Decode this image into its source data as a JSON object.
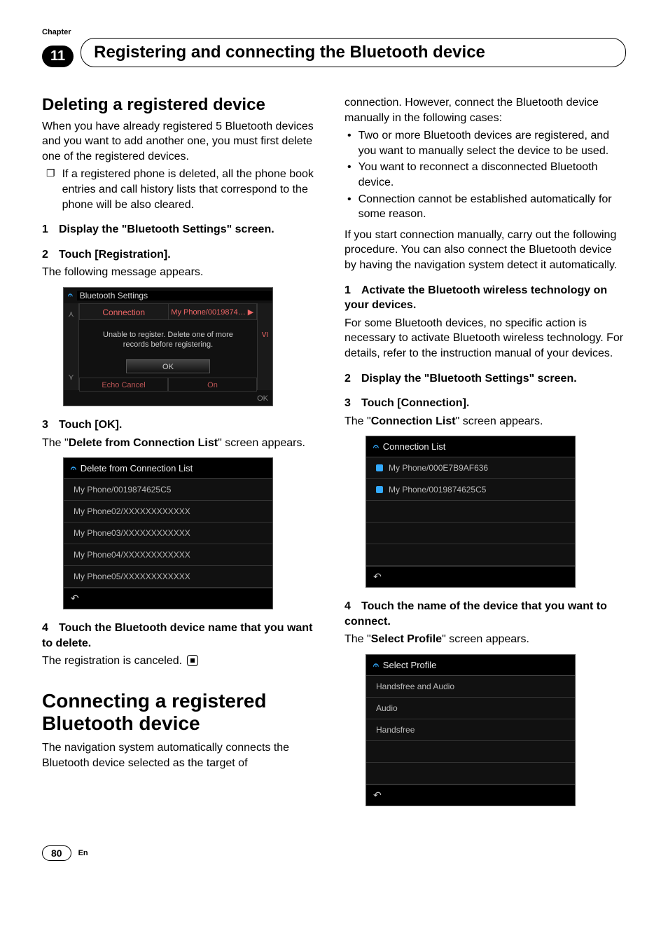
{
  "chapter": {
    "label": "Chapter",
    "number": "11",
    "title": "Registering and connecting the Bluetooth device"
  },
  "left": {
    "h_delete": "Deleting a registered device",
    "delete_intro": "When you have already registered 5 Bluetooth devices and you want to add another one, you must first delete one of the registered devices.",
    "note_marker": "❐",
    "note_text": "If a registered phone is deleted, all the phone book entries and call history lists that correspond to the phone will be also cleared.",
    "s1_head": "Display the \"Bluetooth Settings\" screen.",
    "s2_head": "Touch [Registration].",
    "s2_body": "The following message appears.",
    "s3_head": "Touch [OK].",
    "s3_body_pre": "The \"",
    "s3_body_bold": "Delete from Connection List",
    "s3_body_post": "\" screen appears.",
    "s4_head": "Touch the Bluetooth device name that you want to delete.",
    "s4_body": "The registration is canceled.",
    "h_connect": "Connecting a registered Bluetooth device",
    "connect_intro": "The navigation system automatically connects the Bluetooth device selected as the target of"
  },
  "right": {
    "cont": "connection. However, connect the Bluetooth device manually in the following cases:",
    "bullets": [
      "Two or more Bluetooth devices are registered, and you want to manually select the device to be used.",
      "You want to reconnect a disconnected Bluetooth device.",
      "Connection cannot be established automatically for some reason."
    ],
    "after_bullets": "If you start connection manually, carry out the following procedure. You can also connect the Bluetooth device by having the navigation system detect it automatically.",
    "s1_head": "Activate the Bluetooth wireless technology on your devices.",
    "s1_body": "For some Bluetooth devices, no specific action is necessary to activate Bluetooth wireless technology. For details, refer to the instruction manual of your devices.",
    "s2_head": "Display the \"Bluetooth Settings\" screen.",
    "s3_head": "Touch [Connection].",
    "s3_body_pre": "The \"",
    "s3_body_bold": "Connection List",
    "s3_body_post": "\" screen appears.",
    "s4_head": "Touch the name of the device that you want to connect.",
    "s4_body_pre": "The \"",
    "s4_body_bold": "Select Profile",
    "s4_body_post": "\" screen appears."
  },
  "shot1": {
    "title": "Bluetooth Settings",
    "conn": "Connection",
    "phone": "My Phone/0019874…",
    "msg1": "Unable to register.  Delete one of more",
    "msg2": "records before registering.",
    "ok": "OK",
    "echo": "Echo Cancel",
    "on": "On",
    "vi": "VI",
    "okfoot": "OK"
  },
  "shot2": {
    "title": "Delete from Connection List",
    "items": [
      "My Phone/0019874625C5",
      "My Phone02/XXXXXXXXXXXX",
      "My Phone03/XXXXXXXXXXXX",
      "My Phone04/XXXXXXXXXXXX",
      "My Phone05/XXXXXXXXXXXX"
    ]
  },
  "shot3": {
    "title": "Connection List",
    "items": [
      "My Phone/000E7B9AF636",
      "My Phone/0019874625C5"
    ]
  },
  "shot4": {
    "title": "Select Profile",
    "items": [
      "Handsfree and Audio",
      "Audio",
      "Handsfree"
    ]
  },
  "footer": {
    "page": "80",
    "lang": "En"
  }
}
